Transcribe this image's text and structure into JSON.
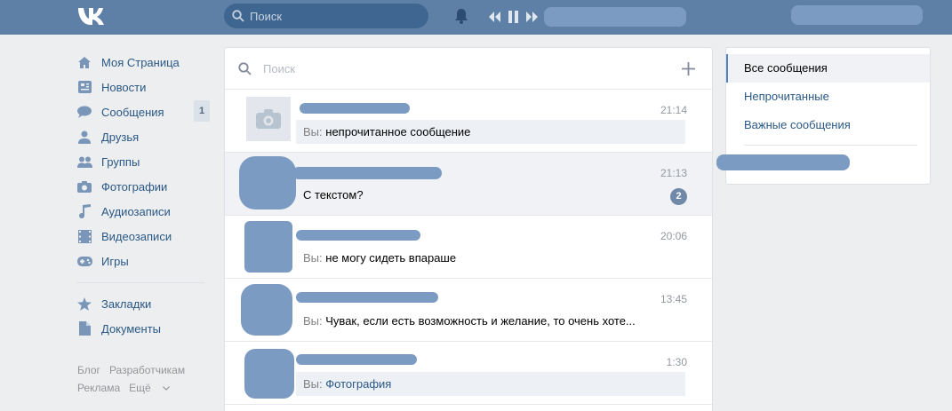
{
  "header": {
    "search_placeholder": "Поиск",
    "icons": [
      "vk-logo",
      "search-icon",
      "bell-icon",
      "prev-track-icon",
      "pause-icon",
      "next-track-icon"
    ]
  },
  "sidebar": {
    "items": [
      {
        "label": "Моя Страница",
        "icon": "home-icon"
      },
      {
        "label": "Новости",
        "icon": "news-icon"
      },
      {
        "label": "Сообщения",
        "icon": "messages-icon",
        "badge": "1"
      },
      {
        "label": "Друзья",
        "icon": "friends-icon"
      },
      {
        "label": "Группы",
        "icon": "groups-icon"
      },
      {
        "label": "Фотографии",
        "icon": "camera-icon"
      },
      {
        "label": "Аудиозаписи",
        "icon": "music-icon"
      },
      {
        "label": "Видеозаписи",
        "icon": "video-icon"
      },
      {
        "label": "Игры",
        "icon": "gamepad-icon"
      }
    ],
    "secondary": [
      {
        "label": "Закладки",
        "icon": "star-icon"
      },
      {
        "label": "Документы",
        "icon": "document-icon"
      }
    ],
    "footer": {
      "blog": "Блог",
      "developers": "Разработчикам",
      "ads": "Реклама",
      "more": "Ещё"
    }
  },
  "messages": {
    "search_placeholder": "Поиск",
    "dialogs": [
      {
        "time": "21:14",
        "you_prefix": "Вы:",
        "text": "непрочитанное сообщение",
        "unread": true
      },
      {
        "time": "21:13",
        "text": "С текстом?",
        "count": "2"
      },
      {
        "time": "20:06",
        "you_prefix": "Вы:",
        "text": "не могу сидеть впараше"
      },
      {
        "time": "13:45",
        "you_prefix": "Вы:",
        "text": "Чувак, если есть возможность и желание, то очень хоте..."
      },
      {
        "time": "1:30",
        "you_prefix": "Вы:",
        "text": "Фотография",
        "unread": true
      }
    ]
  },
  "filters": {
    "all": "Все сообщения",
    "unread": "Непрочитанные",
    "important": "Важные сообщения"
  },
  "colors": {
    "header": "#5e80a7",
    "link": "#2a5885",
    "background": "#edeef0",
    "redaction": "#7c9bc2"
  }
}
